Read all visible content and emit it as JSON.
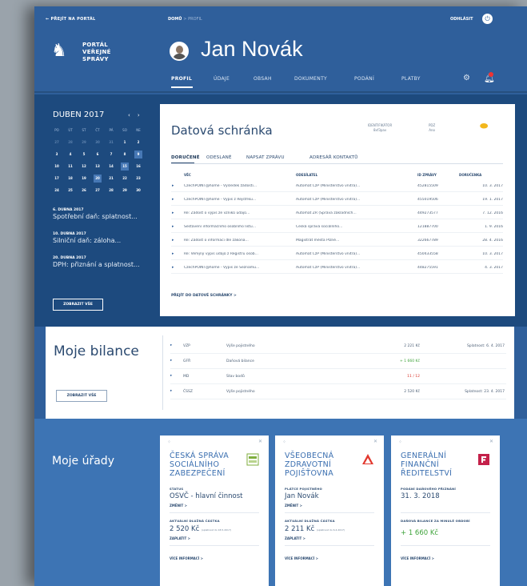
{
  "header": {
    "back_link": "←   PŘEJÍT NA PORTÁL",
    "breadcrumb": {
      "home": "DOMŮ",
      "sep": ">",
      "current": "PROFIL"
    },
    "logout_label": "ODHLÁSIT",
    "logo_lines": [
      "PORTÁL",
      "VEŘEJNÉ",
      "SPRÁVY"
    ],
    "user_name": "Jan Novák",
    "nav_items": [
      "PROFIL",
      "ÚDAJE",
      "OBSAH",
      "DOKUMENTY",
      "PODÁNÍ",
      "PLATBY"
    ]
  },
  "calendar": {
    "title": "DUBEN 2017",
    "weekdays": [
      "PO",
      "ÚT",
      "ST",
      "ČT",
      "PÁ",
      "SO",
      "NE"
    ],
    "weeks": [
      [
        "27",
        "28",
        "29",
        "30",
        "31",
        "1",
        "2"
      ],
      [
        "3",
        "4",
        "5",
        "6",
        "7",
        "8",
        "9"
      ],
      [
        "10",
        "11",
        "12",
        "13",
        "14",
        "15",
        "16"
      ],
      [
        "17",
        "18",
        "19",
        "20",
        "21",
        "22",
        "23"
      ],
      [
        "24",
        "25",
        "26",
        "27",
        "28",
        "29",
        "30"
      ]
    ],
    "events": [
      {
        "date": "6. DUBNA 2017",
        "text": "Spotřební daň: splatnost..."
      },
      {
        "date": "10. DUBNA 2017",
        "text": "Silniční daň: záloha..."
      },
      {
        "date": "20. DUBNA 2017",
        "text": "DPH: přiznání a splatnost..."
      }
    ],
    "show_all": "ZOBRAZIT VŠE"
  },
  "databox": {
    "title": "Datová schránka",
    "stats": [
      {
        "label": "IDENTIFIKÁTOR",
        "value": "8xf3pav"
      },
      {
        "label": "PDZ",
        "value": "Ano"
      }
    ],
    "tabs": [
      "DORUČENÉ",
      "ODESLANÉ",
      "NAPSAT ZPRÁVU",
      "ADRESÁŘ KONTAKTŮ"
    ],
    "columns": [
      "VĚC",
      "ODESÍLATEL",
      "ID ZPRÁVY",
      "DORUČENKA"
    ],
    "rows": [
      {
        "subject": "CzechPOINT@home - Výsledek žádosti...",
        "sender": "Automat CzP (Ministerstvo vnitra)...",
        "id": "452815509",
        "date": "10. 3. 2017"
      },
      {
        "subject": "CzechPOINT@home - Výpis z Rejstříku...",
        "sender": "Automat CzP (Ministerstvo vnitra)...",
        "id": "455019506",
        "date": "19. 1. 2017"
      },
      {
        "subject": "Re: Žádost o výpis ze vzniků údajů...",
        "sender": "Automat ZR (Správa základních...",
        "id": "449273577",
        "date": "7. 12. 2016"
      },
      {
        "subject": "Sestavení informačního osobního listu...",
        "sender": "Česká správa sociálního...",
        "id": "121887700",
        "date": "1. 9. 2016"
      },
      {
        "subject": "Re: Žádost o informaci dle zákona...",
        "sender": "Magistrát města Plzně...",
        "id": "322667789",
        "date": "28. 4. 2016"
      },
      {
        "subject": "Re: Veřejný výpis údajů z Registru osob...",
        "sender": "Automat CzP (Ministerstvo vnitra)...",
        "id": "450433558",
        "date": "10. 3. 2017"
      },
      {
        "subject": "CzechPOINT@home - Výpis ze Seznamu...",
        "sender": "Automat CzP (Ministerstvo vnitra)...",
        "id": "448275591",
        "date": "4. 3. 2017"
      }
    ],
    "more_link": "PŘEJÍT DO DATOVÉ SCHRÁNKY  >"
  },
  "balance": {
    "title": "Moje bilance",
    "show_all": "ZOBRAZIT VŠE",
    "rows": [
      {
        "code": "VZP",
        "desc": "Výše pojistného",
        "amount": "2 221 Kč",
        "due": "Splatnost: 6. 4. 2017",
        "color": "#4b5e75"
      },
      {
        "code": "GFŘ",
        "desc": "Daňová bilance",
        "amount": "+ 1 660 Kč",
        "due": "",
        "color": "#3ea33a"
      },
      {
        "code": "MD",
        "desc": "Stav bodů",
        "amount": "11 / 12",
        "due": "",
        "color": "#d9342b"
      },
      {
        "code": "ČSSZ",
        "desc": "Výše pojistného",
        "amount": "2 520 Kč",
        "due": "Splatnost: 23. 4. 2017",
        "color": "#4b5e75"
      }
    ]
  },
  "offices": {
    "title": "Moje úřady",
    "cards": [
      {
        "name_lines": [
          "ČESKÁ SPRÁVA",
          "SOCIÁLNÍHO",
          "ZABEZPEČENÍ"
        ],
        "icon": "cssz-logo",
        "label1": "STATUS",
        "value1": "OSVČ - hlavní činnost",
        "link1": "ZMĚNIT  >",
        "label2": "AKTUÁLNÍ DLUŽNÁ ČÁSTKA",
        "value2": "2 520 Kč",
        "value2_note": "(splatnost do 18.5.2017)",
        "link2": "ZAPLATIT  >",
        "more": "VÍCE INFORMACÍ  >"
      },
      {
        "name_lines": [
          "VŠEOBECNÁ",
          "ZDRAVOTNÍ",
          "POJIŠŤOVNA"
        ],
        "icon": "vzp-logo",
        "label1": "PLÁTCE POJISTNÉHO",
        "value1": "Jan Novák",
        "link1": "ZMĚNIT  >",
        "label2": "AKTUÁLNÍ DLUŽNÁ ČÁSTKA",
        "value2": "2 211 Kč",
        "value2_note": "(splatnost do 6.4.2017)",
        "link2": "ZAPLATIT  >",
        "more": "VÍCE INFORMACÍ  >"
      },
      {
        "name_lines": [
          "GENERÁLNÍ",
          "FINANČNÍ",
          "ŘEDITELSTVÍ"
        ],
        "icon": "gfr-logo",
        "label1": "PODÁNÍ DAŇOVÉHO PŘIZNÁNÍ",
        "value1": "31. 3. 2018",
        "link1": "",
        "label2": "DAŇOVÁ BILANCE ZA MINULÉ OBDOBÍ",
        "value2": "+ 1 660 Kč",
        "value2_note": "",
        "link2": "",
        "more": "VÍCE INFORMACÍ  >"
      }
    ]
  },
  "colors": {
    "primary": "#2f5f9b",
    "dark": "#1d4a7e",
    "light": "#3d74b4",
    "positive": "#3ea33a",
    "negative": "#d9342b",
    "accent": "#f2b71c"
  }
}
